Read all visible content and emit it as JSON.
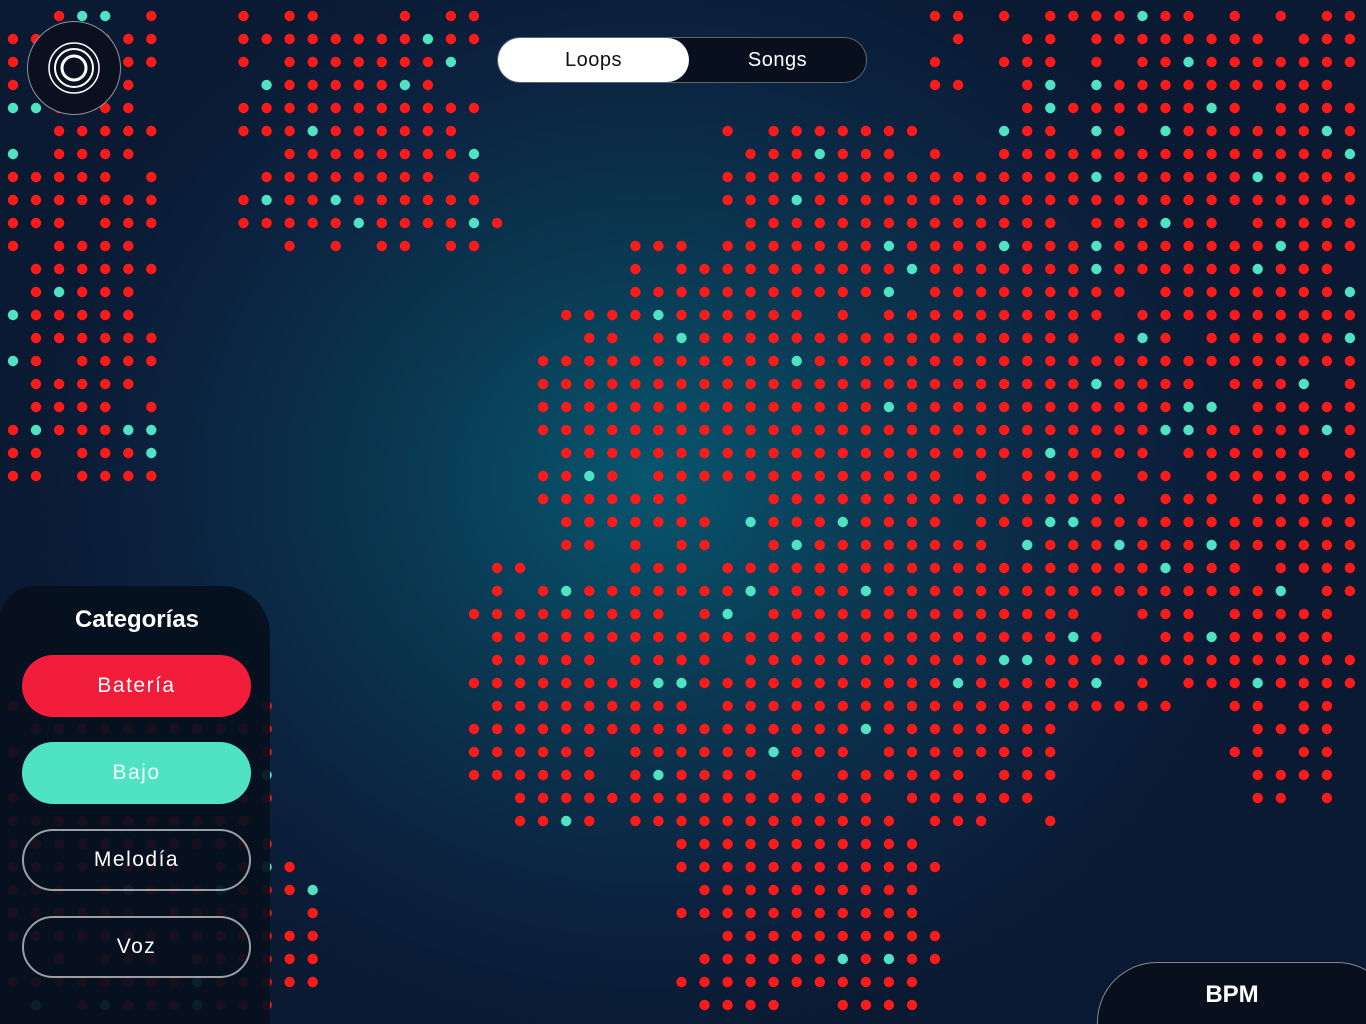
{
  "app": {
    "logo_icon": "concentric-circles-icon"
  },
  "mode_toggle": {
    "active_label": "Loops",
    "inactive_label": "Songs"
  },
  "categories": {
    "title": "Categorías",
    "items": [
      {
        "label": "Batería",
        "color": "#f21d3a",
        "selected": true
      },
      {
        "label": "Bajo",
        "color": "#4fe3c4",
        "selected": true
      },
      {
        "label": "Melodía",
        "selected": false
      },
      {
        "label": "Voz",
        "selected": false
      }
    ]
  },
  "bpm": {
    "label": "BPM"
  },
  "colors": {
    "drum_dot": "#ff1a1a",
    "bass_dot": "#4fe3c4",
    "background": "#0b2340"
  }
}
